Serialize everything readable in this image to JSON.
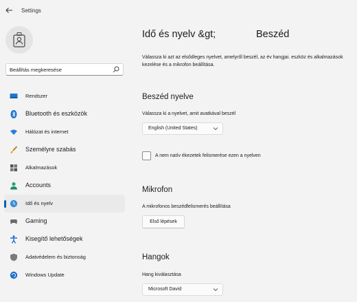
{
  "app": {
    "title": "Settings"
  },
  "search": {
    "placeholder": "Beállítás megkeresése"
  },
  "nav": {
    "items": [
      {
        "label": "Rendszer"
      },
      {
        "label": "Bluetooth és eszközök"
      },
      {
        "label": "Hálózat és internet"
      },
      {
        "label": "Személyre szabás"
      },
      {
        "label": "Alkalmazások"
      },
      {
        "label": "Accounts"
      },
      {
        "label": "Idő és nyelv"
      },
      {
        "label": "Gaming"
      },
      {
        "label": "Kisegítő lehetőségek"
      },
      {
        "label": "Adatvédelem és biztonság"
      },
      {
        "label": "Windows Update"
      }
    ]
  },
  "page": {
    "breadcrumb_parent": "Idő és nyelv",
    "breadcrumb_sep": "&gt;",
    "breadcrumb_current": "Beszéd",
    "description": "Válassza ki azt az elsődleges nyelvet, amelyről beszél, az év hangjai. eszköz és alkalmazások kezelése és a mikrofon beállítása."
  },
  "speech_language": {
    "heading": "Beszéd nyelve",
    "hint": "Válassza ki a nyelvet, amit avatkával beszél",
    "selected": "English (United States)",
    "checkbox_label": "A nem natív ékezetek felismerése ezen a nyelven"
  },
  "microphone": {
    "heading": "Mikrofon",
    "hint": "A mikrofonos beszédfelismerés beállítása",
    "button": "Első lépések"
  },
  "voices": {
    "heading": "Hangok",
    "hint": "Hang kiválasztása",
    "selected": "Microsoft David"
  },
  "colors": {
    "accent": "#005fb8"
  }
}
